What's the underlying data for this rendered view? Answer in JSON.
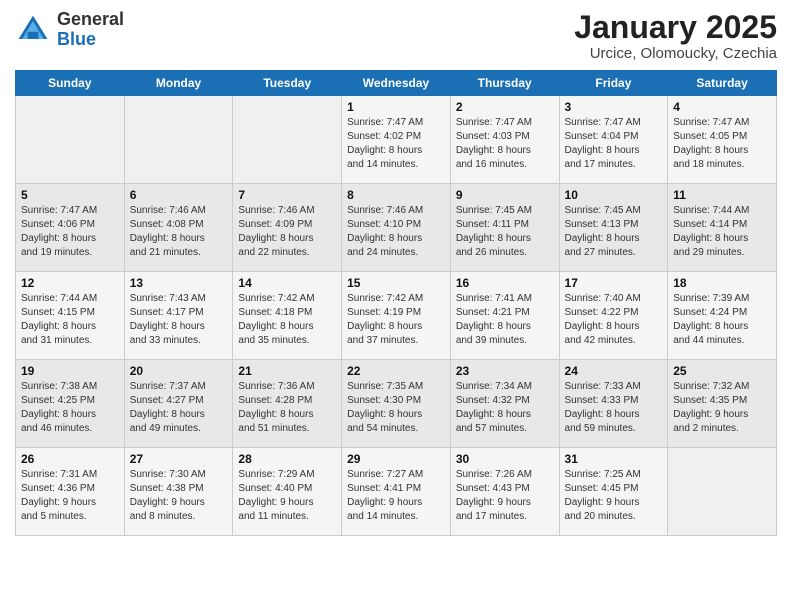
{
  "header": {
    "logo_general": "General",
    "logo_blue": "Blue",
    "title": "January 2025",
    "subtitle": "Urcice, Olomoucky, Czechia"
  },
  "weekdays": [
    "Sunday",
    "Monday",
    "Tuesday",
    "Wednesday",
    "Thursday",
    "Friday",
    "Saturday"
  ],
  "weeks": [
    [
      {
        "day": "",
        "info": ""
      },
      {
        "day": "",
        "info": ""
      },
      {
        "day": "",
        "info": ""
      },
      {
        "day": "1",
        "info": "Sunrise: 7:47 AM\nSunset: 4:02 PM\nDaylight: 8 hours\nand 14 minutes."
      },
      {
        "day": "2",
        "info": "Sunrise: 7:47 AM\nSunset: 4:03 PM\nDaylight: 8 hours\nand 16 minutes."
      },
      {
        "day": "3",
        "info": "Sunrise: 7:47 AM\nSunset: 4:04 PM\nDaylight: 8 hours\nand 17 minutes."
      },
      {
        "day": "4",
        "info": "Sunrise: 7:47 AM\nSunset: 4:05 PM\nDaylight: 8 hours\nand 18 minutes."
      }
    ],
    [
      {
        "day": "5",
        "info": "Sunrise: 7:47 AM\nSunset: 4:06 PM\nDaylight: 8 hours\nand 19 minutes."
      },
      {
        "day": "6",
        "info": "Sunrise: 7:46 AM\nSunset: 4:08 PM\nDaylight: 8 hours\nand 21 minutes."
      },
      {
        "day": "7",
        "info": "Sunrise: 7:46 AM\nSunset: 4:09 PM\nDaylight: 8 hours\nand 22 minutes."
      },
      {
        "day": "8",
        "info": "Sunrise: 7:46 AM\nSunset: 4:10 PM\nDaylight: 8 hours\nand 24 minutes."
      },
      {
        "day": "9",
        "info": "Sunrise: 7:45 AM\nSunset: 4:11 PM\nDaylight: 8 hours\nand 26 minutes."
      },
      {
        "day": "10",
        "info": "Sunrise: 7:45 AM\nSunset: 4:13 PM\nDaylight: 8 hours\nand 27 minutes."
      },
      {
        "day": "11",
        "info": "Sunrise: 7:44 AM\nSunset: 4:14 PM\nDaylight: 8 hours\nand 29 minutes."
      }
    ],
    [
      {
        "day": "12",
        "info": "Sunrise: 7:44 AM\nSunset: 4:15 PM\nDaylight: 8 hours\nand 31 minutes."
      },
      {
        "day": "13",
        "info": "Sunrise: 7:43 AM\nSunset: 4:17 PM\nDaylight: 8 hours\nand 33 minutes."
      },
      {
        "day": "14",
        "info": "Sunrise: 7:42 AM\nSunset: 4:18 PM\nDaylight: 8 hours\nand 35 minutes."
      },
      {
        "day": "15",
        "info": "Sunrise: 7:42 AM\nSunset: 4:19 PM\nDaylight: 8 hours\nand 37 minutes."
      },
      {
        "day": "16",
        "info": "Sunrise: 7:41 AM\nSunset: 4:21 PM\nDaylight: 8 hours\nand 39 minutes."
      },
      {
        "day": "17",
        "info": "Sunrise: 7:40 AM\nSunset: 4:22 PM\nDaylight: 8 hours\nand 42 minutes."
      },
      {
        "day": "18",
        "info": "Sunrise: 7:39 AM\nSunset: 4:24 PM\nDaylight: 8 hours\nand 44 minutes."
      }
    ],
    [
      {
        "day": "19",
        "info": "Sunrise: 7:38 AM\nSunset: 4:25 PM\nDaylight: 8 hours\nand 46 minutes."
      },
      {
        "day": "20",
        "info": "Sunrise: 7:37 AM\nSunset: 4:27 PM\nDaylight: 8 hours\nand 49 minutes."
      },
      {
        "day": "21",
        "info": "Sunrise: 7:36 AM\nSunset: 4:28 PM\nDaylight: 8 hours\nand 51 minutes."
      },
      {
        "day": "22",
        "info": "Sunrise: 7:35 AM\nSunset: 4:30 PM\nDaylight: 8 hours\nand 54 minutes."
      },
      {
        "day": "23",
        "info": "Sunrise: 7:34 AM\nSunset: 4:32 PM\nDaylight: 8 hours\nand 57 minutes."
      },
      {
        "day": "24",
        "info": "Sunrise: 7:33 AM\nSunset: 4:33 PM\nDaylight: 8 hours\nand 59 minutes."
      },
      {
        "day": "25",
        "info": "Sunrise: 7:32 AM\nSunset: 4:35 PM\nDaylight: 9 hours\nand 2 minutes."
      }
    ],
    [
      {
        "day": "26",
        "info": "Sunrise: 7:31 AM\nSunset: 4:36 PM\nDaylight: 9 hours\nand 5 minutes."
      },
      {
        "day": "27",
        "info": "Sunrise: 7:30 AM\nSunset: 4:38 PM\nDaylight: 9 hours\nand 8 minutes."
      },
      {
        "day": "28",
        "info": "Sunrise: 7:29 AM\nSunset: 4:40 PM\nDaylight: 9 hours\nand 11 minutes."
      },
      {
        "day": "29",
        "info": "Sunrise: 7:27 AM\nSunset: 4:41 PM\nDaylight: 9 hours\nand 14 minutes."
      },
      {
        "day": "30",
        "info": "Sunrise: 7:26 AM\nSunset: 4:43 PM\nDaylight: 9 hours\nand 17 minutes."
      },
      {
        "day": "31",
        "info": "Sunrise: 7:25 AM\nSunset: 4:45 PM\nDaylight: 9 hours\nand 20 minutes."
      },
      {
        "day": "",
        "info": ""
      }
    ]
  ]
}
